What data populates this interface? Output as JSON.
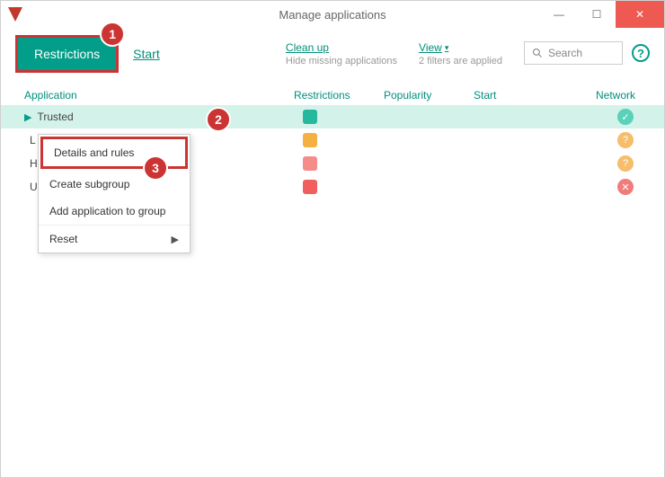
{
  "window": {
    "title": "Manage applications"
  },
  "toolbar": {
    "restrictions_label": "Restrictions",
    "start_label": "Start",
    "cleanup": {
      "label": "Clean up",
      "sub": "Hide missing applications"
    },
    "view": {
      "label": "View",
      "sub": "2 filters are applied"
    },
    "search_placeholder": "Search",
    "help": "?"
  },
  "table": {
    "headers": {
      "application": "Application",
      "restrictions": "Restrictions",
      "popularity": "Popularity",
      "start": "Start",
      "network": "Network"
    },
    "rows": [
      {
        "name": "Trusted",
        "expanded": true,
        "restriction_color": "green",
        "network": "ok"
      },
      {
        "short": "L",
        "restriction_color": "orange",
        "network": "q"
      },
      {
        "short": "H",
        "restriction_color": "pink",
        "network": "q"
      },
      {
        "short": "U",
        "restriction_color": "red",
        "network": "x"
      }
    ]
  },
  "context_menu": {
    "details": "Details and rules",
    "create_subgroup": "Create subgroup",
    "add_app": "Add application to group",
    "reset": "Reset"
  },
  "callouts": {
    "one": "1",
    "two": "2",
    "three": "3"
  }
}
